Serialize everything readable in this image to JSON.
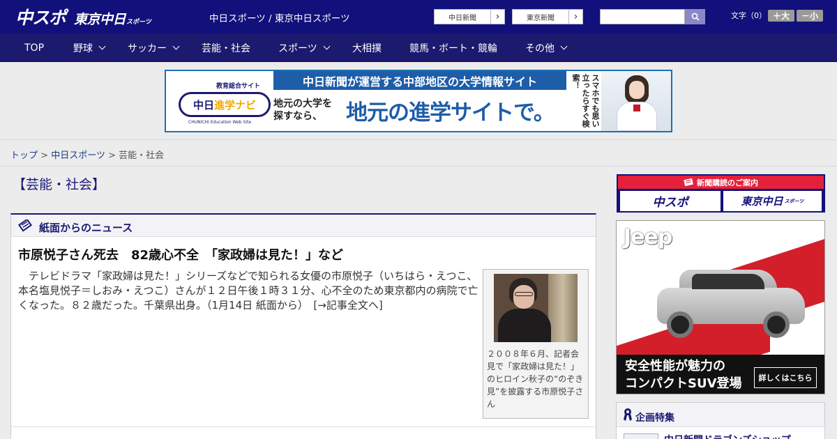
{
  "header": {
    "logo_primary": "中スポ",
    "logo_secondary": "東京中日",
    "logo_secondary_suffix": "スポーツ",
    "site_title": "中日スポーツ / 東京中日スポーツ",
    "external_links": [
      "中日新聞",
      "東京新聞"
    ],
    "search_placeholder": "",
    "font_size_label": "文字（0）",
    "font_bigger": "＋大",
    "font_smaller": "－小"
  },
  "nav": {
    "items": [
      {
        "label": "TOP",
        "dropdown": false
      },
      {
        "label": "野球",
        "dropdown": true
      },
      {
        "label": "サッカー",
        "dropdown": true
      },
      {
        "label": "芸能・社会",
        "dropdown": false
      },
      {
        "label": "スポーツ",
        "dropdown": true
      },
      {
        "label": "大相撲",
        "dropdown": false
      },
      {
        "label": "競馬・ボート・競輪",
        "dropdown": false
      },
      {
        "label": "その他",
        "dropdown": true
      }
    ]
  },
  "banner": {
    "badge": "教育総合サイト",
    "logo_text_a": "中日",
    "logo_text_b": "進学ナビ",
    "logo_sub": "CHUNICHI Education Web Site",
    "strip": "中日新聞が運営する中部地区の大学情報サイト",
    "small_line1": "地元の大学を",
    "small_line2": "探すなら、",
    "big": "地元の進学サイトで。",
    "vertical": "スマホでも思い立ったらすぐ検索！"
  },
  "breadcrumb": {
    "items": [
      "トップ",
      "中日スポーツ"
    ],
    "current": "芸能・社会",
    "separator": ">"
  },
  "section_title": "【芸能・社会】",
  "news_panel": {
    "heading": "紙面からのニュース",
    "headline": "市原悦子さん死去　82歳心不全　「家政婦は見た！」など",
    "body": "テレビドラマ「家政婦は見た！」シリーズなどで知られる女優の市原悦子（いちはら・えつこ、本名塩見悦子＝しおみ・えつこ）さんが１２日午後１時３１分、心不全のため東京都内の病院で亡くなった。８２歳だった。千葉県出身。（1月14日 紙面から）　[→記事全文へ]",
    "photo_caption": "２００８年６月、記者会見で「家政婦は見た！」のヒロイン秋子の“のぞき見”を披露する市原悦子さん"
  },
  "sidebar": {
    "subscribe_title": "新聞購読のご案内",
    "subscribe_logo_1": "中スポ",
    "subscribe_logo_2": "東京中日",
    "subscribe_logo_2_suffix": "スポーツ",
    "ad_brand": "Jeep",
    "ad_line1": "安全性能が魅力の",
    "ad_line2": "コンパクトSUV登場",
    "ad_button": "詳しくはこちら",
    "feature_heading": "企画特集",
    "feature_item": "中日新聞ドラゴンズショップ"
  },
  "colors": {
    "header_bg": "#12107a",
    "nav_bg": "#1b1a6e",
    "accent_blue": "#1e5da8",
    "subscribe_red": "#e4213a"
  }
}
